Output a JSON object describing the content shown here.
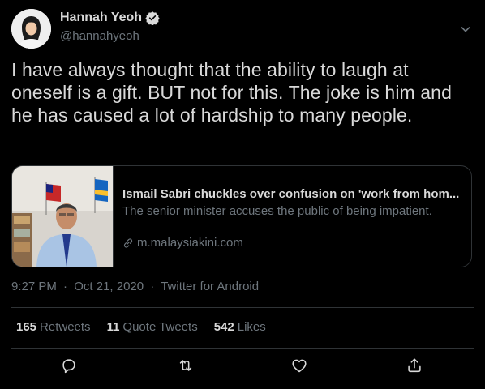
{
  "author": {
    "name": "Hannah Yeoh",
    "handle": "@hannahyeoh",
    "verified": true
  },
  "tweet": {
    "text": "I have always thought that the ability to laugh at oneself is a gift. BUT not for this. The joke is him and he has caused a lot of hardship to many people."
  },
  "card": {
    "title": "Ismail Sabri chuckles over confusion on 'work from hom...",
    "description": "The senior minister accuses the public of being impatient.",
    "domain": "m.malaysiakini.com"
  },
  "meta": {
    "time": "9:27 PM",
    "date": "Oct 21, 2020",
    "source": "Twitter for Android",
    "separator": "·"
  },
  "stats": {
    "retweets_count": "165",
    "retweets_label": "Retweets",
    "quotes_count": "11",
    "quotes_label": "Quote Tweets",
    "likes_count": "542",
    "likes_label": "Likes"
  },
  "actions": [
    "reply-icon",
    "retweet-icon",
    "like-icon",
    "share-icon"
  ],
  "colors": {
    "background": "#000000",
    "text": "#d9d9d9",
    "secondary": "#6e767d",
    "border": "#2f3336",
    "verified": "#d9d9d9"
  }
}
